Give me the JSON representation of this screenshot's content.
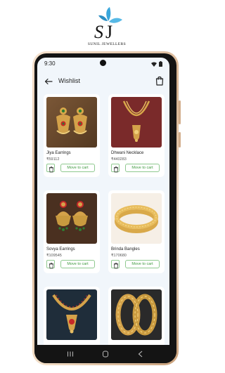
{
  "brand": {
    "monogram": "SJ",
    "name": "SUNIL JEWELLERS"
  },
  "status_bar": {
    "time": "9:30"
  },
  "app_bar": {
    "title": "Wishlist"
  },
  "wishlist": [
    {
      "name": "Jiya Earrings",
      "price": "₹59112",
      "button": "Move to cart"
    },
    {
      "name": "Dhwani Necklace",
      "price": "₹440283",
      "button": "Move to cart"
    },
    {
      "name": "Sovya Earrings",
      "price": "₹109545",
      "button": "Move to cart"
    },
    {
      "name": "Brinda Bangles",
      "price": "₹170680",
      "button": "Move to cart"
    },
    {
      "name": "",
      "price": "",
      "button": ""
    },
    {
      "name": "",
      "price": "",
      "button": ""
    }
  ],
  "icons": [
    "back-arrow-icon",
    "shopping-bag-icon",
    "trash-icon",
    "wifi-icon",
    "battery-icon"
  ],
  "colors": {
    "accent": "#3f9a3f",
    "screen_bg": "#f1f6fb",
    "gold": "#d4a24a",
    "logo_blue": "#3aa7dc"
  }
}
